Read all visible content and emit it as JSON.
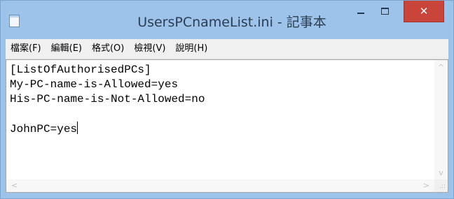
{
  "window": {
    "title": "UsersPCnameList.ini - 記事本",
    "controls": {
      "minimize_icon": "minimize-icon",
      "maximize_icon": "maximize-icon",
      "close_icon": "close-icon",
      "close_label": "✕"
    }
  },
  "menu": {
    "items": [
      {
        "label": "檔案(F)"
      },
      {
        "label": "編輯(E)"
      },
      {
        "label": "格式(O)"
      },
      {
        "label": "檢視(V)"
      },
      {
        "label": "說明(H)"
      }
    ]
  },
  "editor": {
    "lines": [
      "[ListOfAuthorisedPCs]",
      "My-PC-name-is-Allowed=yes",
      "His-PC-name-is-Not-Allowed=no",
      "",
      "JohnPC=yes"
    ]
  },
  "scrollbars": {
    "up_arrow": "^",
    "down_arrow": "v",
    "left_arrow": "<",
    "right_arrow": ">",
    "grip": ".::"
  },
  "colors": {
    "titlebar": "#9ec3ea",
    "close_button": "#c9443a",
    "menubar": "#f0f0f0"
  }
}
